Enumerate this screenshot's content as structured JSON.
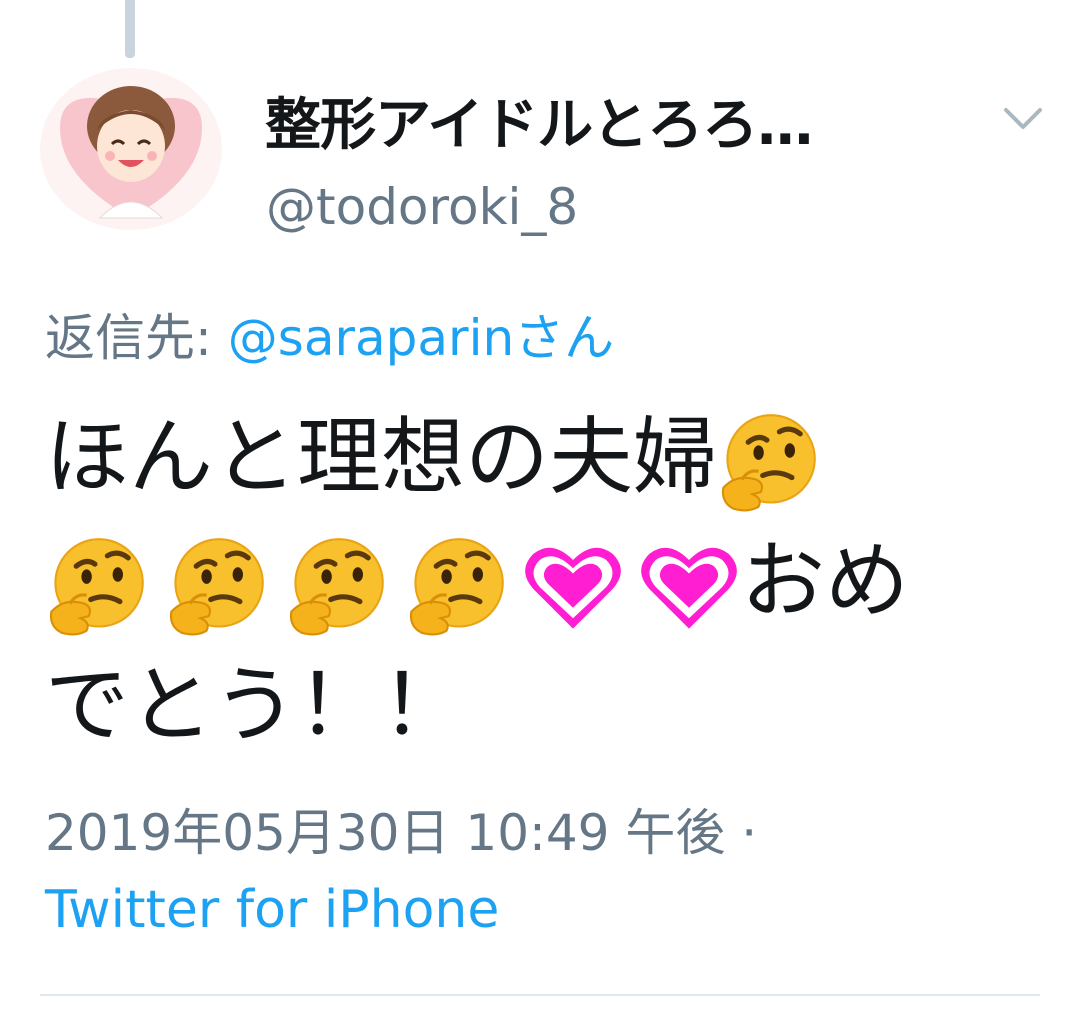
{
  "tweet": {
    "author": {
      "display_name": "整形アイドルとろろ…",
      "handle": "@todoroki_8",
      "avatar": "illustrated-girl-avatar"
    },
    "reply_prefix": "返信先:",
    "reply_mention": "@saraparin",
    "reply_suffix": "さん",
    "text_part1": "ほんと理想の夫婦",
    "text_part2": "おめ",
    "text_part3": "でとう！！",
    "emojis": [
      "thinking-face",
      "thinking-face",
      "thinking-face",
      "thinking-face",
      "thinking-face",
      "heart-outline",
      "heart-outline"
    ],
    "timestamp": "2019年05月30日 10:49 午後 ·",
    "source": "Twitter for iPhone"
  },
  "icons": {
    "more_menu": "chevron-down-icon"
  },
  "colors": {
    "text": "#14171a",
    "secondary": "#657786",
    "link": "#1da1f2",
    "heart": "#ff1ed2"
  }
}
